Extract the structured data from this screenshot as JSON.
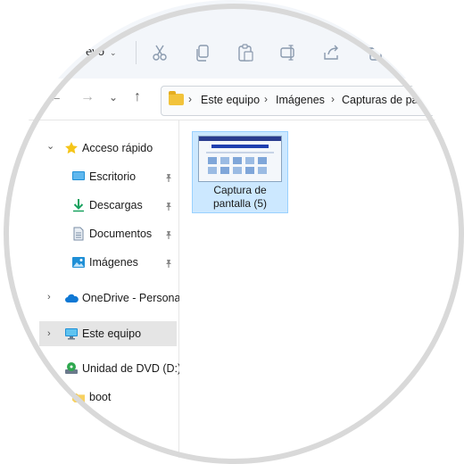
{
  "toolbar": {
    "new_label": "evo",
    "new_chevron": "⌄",
    "icons": [
      "cut-icon",
      "copy-icon",
      "paste-icon",
      "rename-icon",
      "share-icon"
    ]
  },
  "navigation": {
    "back_icon": "←",
    "forward_icon": "→",
    "recent_icon": "⌄",
    "up_icon": "↑"
  },
  "address": {
    "crumbs": [
      "Este equipo",
      "Imágenes",
      "Capturas de pa"
    ],
    "separator": "›"
  },
  "sidebar": {
    "items": [
      {
        "label": "Acceso rápido",
        "icon": "star-icon",
        "pinned": false
      },
      {
        "label": "Escritorio",
        "icon": "desktop-icon",
        "pinned": true
      },
      {
        "label": "Descargas",
        "icon": "download-icon",
        "pinned": true
      },
      {
        "label": "Documentos",
        "icon": "document-icon",
        "pinned": true
      },
      {
        "label": "Imágenes",
        "icon": "image-icon",
        "pinned": true
      },
      {
        "label": "OneDrive - Personal",
        "icon": "cloud-icon",
        "pinned": false
      },
      {
        "label": "Este equipo",
        "icon": "monitor-icon",
        "pinned": false,
        "selected": true
      },
      {
        "label": "Unidad de DVD (D:)",
        "icon": "dvd-icon",
        "pinned": false
      },
      {
        "label": "boot",
        "icon": "folder-icon",
        "pinned": false
      }
    ],
    "expand_icon": "›",
    "collapse_icon": "⌄"
  },
  "files": [
    {
      "name": "Captura de pantalla (5)",
      "line1": "Captura de",
      "line2": "pantalla (5)",
      "selected": true
    }
  ],
  "colors": {
    "accent": "#0067c0",
    "selection": "#cce8ff",
    "folder": "#f2c33b"
  }
}
